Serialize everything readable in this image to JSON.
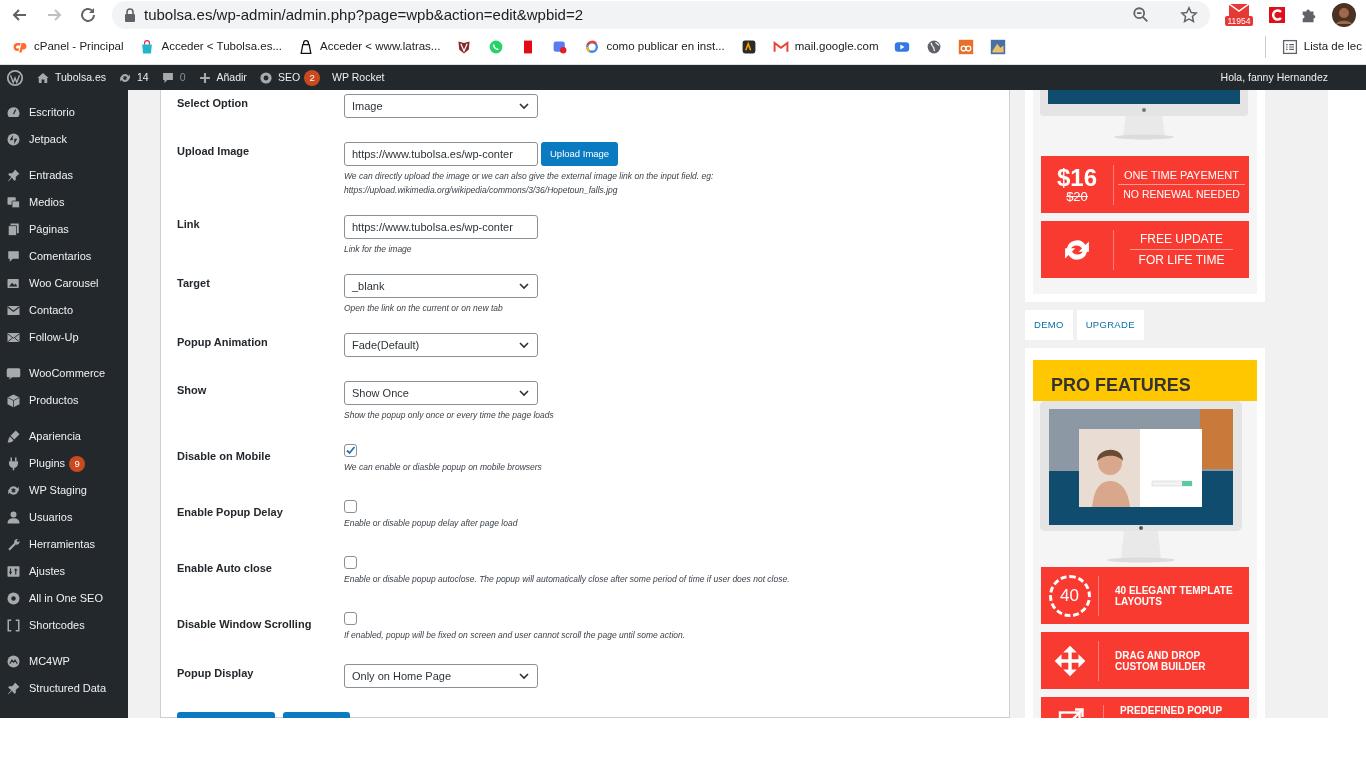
{
  "browser": {
    "url": "tubolsa.es/wp-admin/admin.php?page=wpb&action=edit&wpbid=2",
    "mail_count": "11954",
    "reading_list": "Lista de lec"
  },
  "bookmarks": [
    {
      "kind": "link",
      "label": "cPanel - Principal"
    },
    {
      "kind": "link",
      "label": "Acceder < Tubolsa.es..."
    },
    {
      "kind": "link",
      "label": "Acceder < www.latras..."
    },
    {
      "kind": "icon"
    },
    {
      "kind": "icon"
    },
    {
      "kind": "icon"
    },
    {
      "kind": "icon"
    },
    {
      "kind": "link",
      "label": "como publicar en inst..."
    },
    {
      "kind": "icon"
    },
    {
      "kind": "link",
      "label": "mail.google.com"
    },
    {
      "kind": "icon"
    },
    {
      "kind": "icon"
    },
    {
      "kind": "icon"
    },
    {
      "kind": "icon"
    }
  ],
  "admin_bar": {
    "items": [
      {
        "label": "Tubolsa.es",
        "dim": false
      },
      {
        "label": "14",
        "dim": false
      },
      {
        "label": "0",
        "dim": true
      },
      {
        "label": "Añadir",
        "dim": false
      },
      {
        "label": "SEO",
        "badge": "2",
        "dim": false
      },
      {
        "label": "WP Rocket",
        "dim": false
      }
    ],
    "greeting": "Hola, fanny Hernandez"
  },
  "sidebar": {
    "groups": [
      {
        "items": [
          {
            "label": "Escritorio"
          },
          {
            "label": "Jetpack"
          }
        ]
      },
      {
        "items": [
          {
            "label": "Entradas"
          },
          {
            "label": "Medios"
          },
          {
            "label": "Páginas"
          },
          {
            "label": "Comentarios"
          },
          {
            "label": "Woo Carousel"
          },
          {
            "label": "Contacto"
          },
          {
            "label": "Follow-Up"
          }
        ]
      },
      {
        "items": [
          {
            "label": "WooCommerce"
          },
          {
            "label": "Productos"
          }
        ]
      },
      {
        "items": [
          {
            "label": "Apariencia"
          },
          {
            "label": "Plugins",
            "badge": "9"
          },
          {
            "label": "WP Staging"
          },
          {
            "label": "Usuarios"
          },
          {
            "label": "Herramientas"
          },
          {
            "label": "Ajustes"
          },
          {
            "label": "All in One SEO"
          },
          {
            "label": "Shortcodes"
          }
        ]
      },
      {
        "items": [
          {
            "label": "MC4WP"
          },
          {
            "label": "Structured Data"
          }
        ]
      }
    ]
  },
  "form": {
    "fields": [
      {
        "kind": "select",
        "label": "Select Option",
        "value": "Image"
      },
      {
        "kind": "upload",
        "label": "Upload Image",
        "value": "https://www.tubolsa.es/wp-conter",
        "button": "Upload Image",
        "help": [
          "We can directly upload the image or we can also give the external image link on the input field. eg:",
          "https://upload.wikimedia.org/wikipedia/commons/3/36/Hopetoun_falls.jpg"
        ]
      },
      {
        "kind": "input",
        "label": "Link",
        "value": "https://www.tubolsa.es/wp-conter",
        "help": [
          "Link for the image"
        ]
      },
      {
        "kind": "select",
        "label": "Target",
        "value": "_blank",
        "help": [
          "Open the link on the current or on new tab"
        ]
      },
      {
        "kind": "select",
        "label": "Popup Animation",
        "value": "Fade(Default)"
      },
      {
        "kind": "select",
        "label": "Show",
        "value": "Show Once",
        "help": [
          "Show the popup only once or every time the page loads"
        ]
      },
      {
        "kind": "checkbox",
        "label": "Disable on Mobile",
        "checked": true,
        "help": [
          "We can enable or diasble popup on mobile browsers"
        ]
      },
      {
        "kind": "checkbox",
        "label": "Enable Popup Delay",
        "checked": false,
        "help": [
          "Enable or disable popup delay after page load"
        ]
      },
      {
        "kind": "checkbox",
        "label": "Enable Auto close",
        "checked": false,
        "help": [
          "Enable or disable popup autoclose. The popup will automatically close after some period of time if user does not close."
        ]
      },
      {
        "kind": "checkbox",
        "label": "Disable Window Scrolling",
        "checked": false,
        "help": [
          "If enabled, popup will be fixed on screen and user cannot scroll the page until some action."
        ]
      },
      {
        "kind": "select",
        "label": "Popup Display",
        "value": "Only on Home Page"
      }
    ]
  },
  "promo": {
    "pricing": {
      "price": "$16",
      "old_price": "$20",
      "line_1": "ONE TIME PAYEMENT",
      "line_2": "NO RENEWAL NEEDED"
    },
    "update": {
      "line_1": "FREE UPDATE",
      "line_2": "FOR LIFE TIME"
    },
    "buttons": [
      {
        "label": "DEMO"
      },
      {
        "label": "UPGRADE"
      }
    ],
    "features_title": "PRO FEATURES",
    "features": [
      {
        "kind": "count",
        "count": "40",
        "label": "40 ELEGANT TEMPLATE LAYOUTS"
      },
      {
        "kind": "move",
        "label": "DRAG AND DROP CUSTOM BUILDER"
      },
      {
        "kind": "popup",
        "label": "PREDEFINED POPUP"
      }
    ]
  }
}
